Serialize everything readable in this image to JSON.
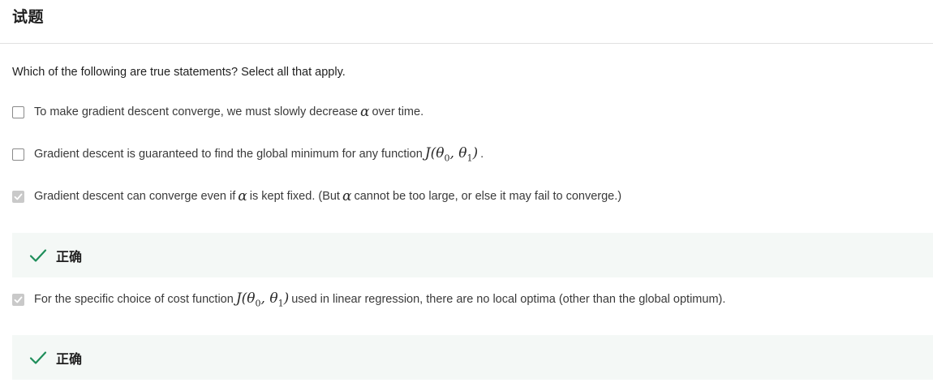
{
  "header": {
    "title": "试题"
  },
  "question": {
    "prompt": "Which of the following are true statements? Select all that apply."
  },
  "options": [
    {
      "checked": false,
      "text_before": "To make gradient descent converge, we must slowly decrease",
      "math": "α",
      "text_after": "over time."
    },
    {
      "checked": false,
      "text_before": "Gradient descent is guaranteed to find the global minimum for any function",
      "math": "J(θ0, θ1)",
      "text_after": "."
    },
    {
      "checked": true,
      "text_before": "Gradient descent can converge even if",
      "math": "α",
      "text_mid": "is kept fixed. (But",
      "math2": "α",
      "text_after": "cannot be too large, or else it may fail to converge.)"
    },
    {
      "checked": true,
      "text_before": "For the specific choice of cost function",
      "math": "J(θ0, θ1)",
      "text_after": "used in linear regression, there are no local optima (other than the global optimum)."
    }
  ],
  "feedback": [
    {
      "label": "正确",
      "icon": "checkmark-icon",
      "color": "#1e8e5a"
    },
    {
      "label": "正确",
      "icon": "checkmark-icon",
      "color": "#1e8e5a"
    }
  ]
}
